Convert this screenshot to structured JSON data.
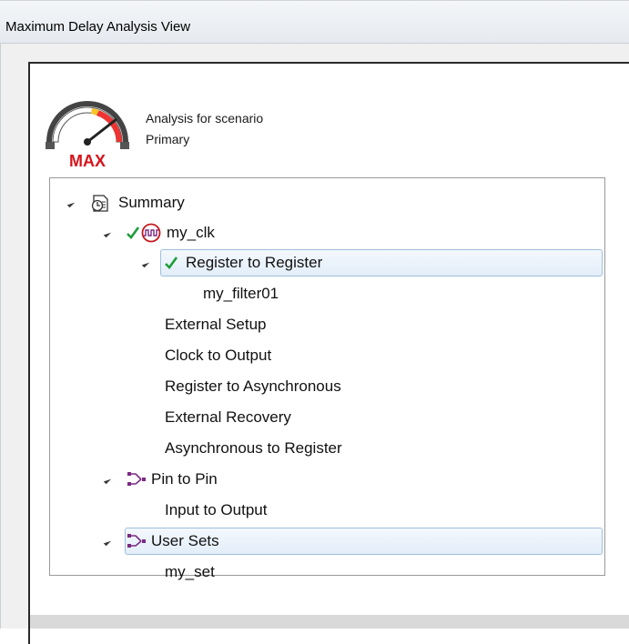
{
  "window": {
    "title": "Maximum Delay Analysis View"
  },
  "header": {
    "gauge_label": "MAX",
    "line1": "Analysis for scenario",
    "line2": "Primary"
  },
  "tree": {
    "summary": "Summary",
    "clock": "my_clk",
    "reg_to_reg": "Register to Register",
    "filter": "my_filter01",
    "external_setup": "External Setup",
    "clock_to_output": "Clock to Output",
    "reg_to_async": "Register to Asynchronous",
    "external_recovery": "External Recovery",
    "async_to_reg": "Asynchronous to Register",
    "pin_to_pin": "Pin to Pin",
    "input_to_output": "Input to Output",
    "user_sets": "User Sets",
    "my_set": "my_set"
  },
  "colors": {
    "selection_border": "#9fc0dd",
    "selection_fill": "#e3eef9",
    "check_green": "#1f9e3a",
    "clock_red": "#c4161c",
    "path_purple": "#7a2a83",
    "max_red": "#d5131b"
  },
  "icons": [
    "max-gauge-icon",
    "summary-icon",
    "clock-icon",
    "check-icon",
    "pin-to-pin-icon",
    "user-sets-icon",
    "expander-icon"
  ]
}
